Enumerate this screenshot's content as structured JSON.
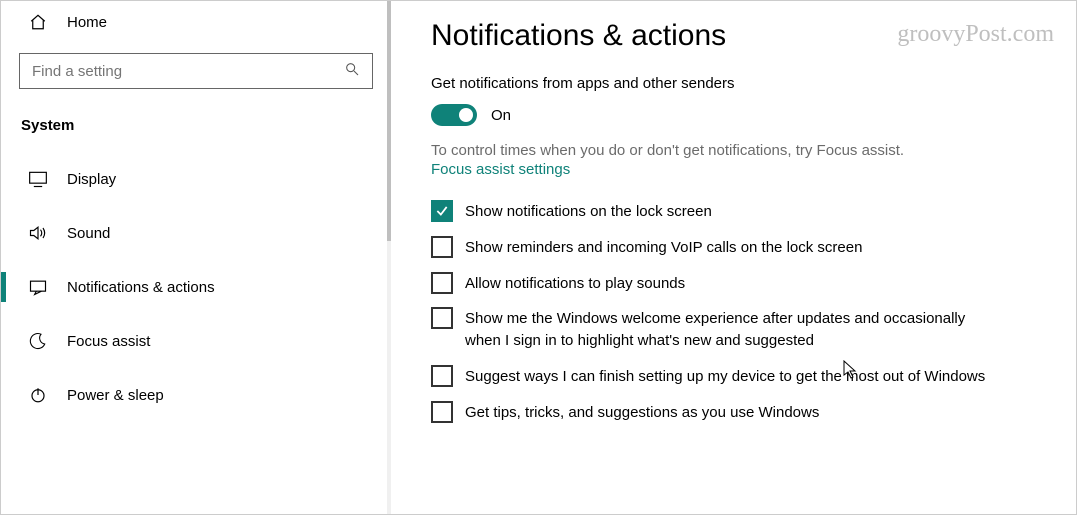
{
  "sidebar": {
    "home_label": "Home",
    "search_placeholder": "Find a setting",
    "section_label": "System",
    "items": [
      {
        "label": "Display"
      },
      {
        "label": "Sound"
      },
      {
        "label": "Notifications & actions"
      },
      {
        "label": "Focus assist"
      },
      {
        "label": "Power & sleep"
      }
    ]
  },
  "main": {
    "title": "Notifications & actions",
    "subtitle": "Get notifications from apps and other senders",
    "toggle_state_label": "On",
    "help_line": "To control times when you do or don't get notifications, try Focus assist.",
    "focus_link": "Focus assist settings",
    "checks": [
      {
        "checked": true,
        "label": "Show notifications on the lock screen"
      },
      {
        "checked": false,
        "label": "Show reminders and incoming VoIP calls on the lock screen"
      },
      {
        "checked": false,
        "label": "Allow notifications to play sounds"
      },
      {
        "checked": false,
        "label": "Show me the Windows welcome experience after updates and occasionally when I sign in to highlight what's new and suggested"
      },
      {
        "checked": false,
        "label": "Suggest ways I can finish setting up my device to get the most out of Windows"
      },
      {
        "checked": false,
        "label": "Get tips, tricks, and suggestions as you use Windows"
      }
    ]
  },
  "watermark": "groovyPost.com"
}
